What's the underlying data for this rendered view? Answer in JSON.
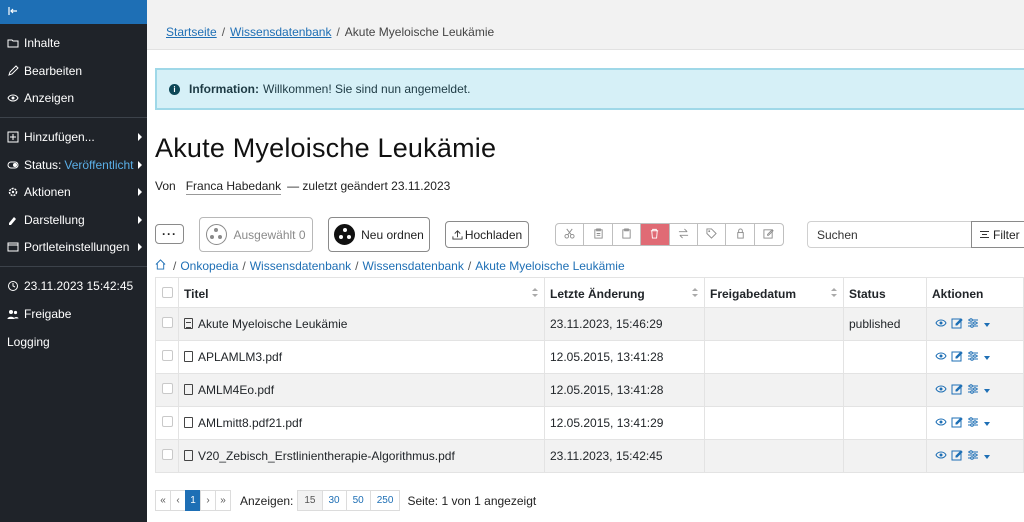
{
  "sidebar": {
    "collapse_icon": "collapse-left-icon",
    "items": [
      {
        "label": "Inhalte",
        "icon": "folder-icon"
      },
      {
        "label": "Bearbeiten",
        "icon": "pencil-icon"
      },
      {
        "label": "Anzeigen",
        "icon": "eye-icon"
      },
      {
        "label": "Hinzufügen...",
        "icon": "plus-square-icon"
      },
      {
        "label": "Status:",
        "value": "Veröffentlicht",
        "icon": "toggle-icon"
      },
      {
        "label": "Aktionen",
        "icon": "gear-icon"
      },
      {
        "label": "Darstellung",
        "icon": "palette-icon"
      },
      {
        "label": "Portleteinstellungen",
        "icon": "window-icon"
      },
      {
        "label": "23.11.2023 15:42:45",
        "icon": "clock-icon"
      },
      {
        "label": "Freigabe",
        "icon": "users-icon"
      },
      {
        "label": "Logging",
        "icon": ""
      }
    ],
    "status_color": "#5aaee6"
  },
  "breadcrumb": {
    "items": [
      "Startseite",
      "Wissensdatenbank"
    ],
    "current": "Akute Myeloische Leukämie",
    "separator": "/"
  },
  "alert": {
    "title": "Information:",
    "message": "Willkommen! Sie sind nun angemeldet."
  },
  "page": {
    "title": "Akute Myeloische Leukämie",
    "byline_prefix": "Von",
    "author": "Franca Habedank",
    "modified": "— zuletzt geändert 23.11.2023"
  },
  "toolbar": {
    "more_label": "···",
    "selected_label": "Ausgewählt 0",
    "order_label": "Neu ordnen",
    "upload_label": "Hochladen",
    "group_icons": [
      "scissors-icon",
      "clipboard-copy-icon",
      "clipboard-paste-icon",
      "trash-icon",
      "swap-icon",
      "tag-icon",
      "lock-icon",
      "edit-icon"
    ],
    "search_placeholder": "Suchen",
    "filter_label": "Filter"
  },
  "path": {
    "items": [
      "Onkopedia",
      "Wissensdatenbank",
      "Wissensdatenbank",
      "Akute Myeloische Leukämie"
    ]
  },
  "table": {
    "columns": [
      "Titel",
      "Letzte Änderung",
      "Freigabedatum",
      "Status",
      "Aktionen"
    ],
    "rows": [
      {
        "title": "Akute Myeloische Leukämie",
        "modified": "23.11.2023, 15:46:29",
        "release": "",
        "status": "published",
        "type": "document"
      },
      {
        "title": "APLAMLM3.pdf",
        "modified": "12.05.2015, 13:41:28",
        "release": "",
        "status": "",
        "type": "file"
      },
      {
        "title": "AMLM4Eo.pdf",
        "modified": "12.05.2015, 13:41:28",
        "release": "",
        "status": "",
        "type": "file"
      },
      {
        "title": "AMLmitt8.pdf21.pdf",
        "modified": "12.05.2015, 13:41:29",
        "release": "",
        "status": "",
        "type": "file"
      },
      {
        "title": "V20_Zebisch_Erstlinientherapie-Algorithmus.pdf",
        "modified": "23.11.2023, 15:42:45",
        "release": "",
        "status": "",
        "type": "file"
      }
    ]
  },
  "pagination": {
    "first": "«",
    "prev": "‹",
    "current": "1",
    "next": "›",
    "last": "»",
    "show_label": "Anzeigen:",
    "sizes": [
      "15",
      "30",
      "50",
      "250"
    ],
    "info": "Seite: 1 von 1 angezeigt"
  }
}
